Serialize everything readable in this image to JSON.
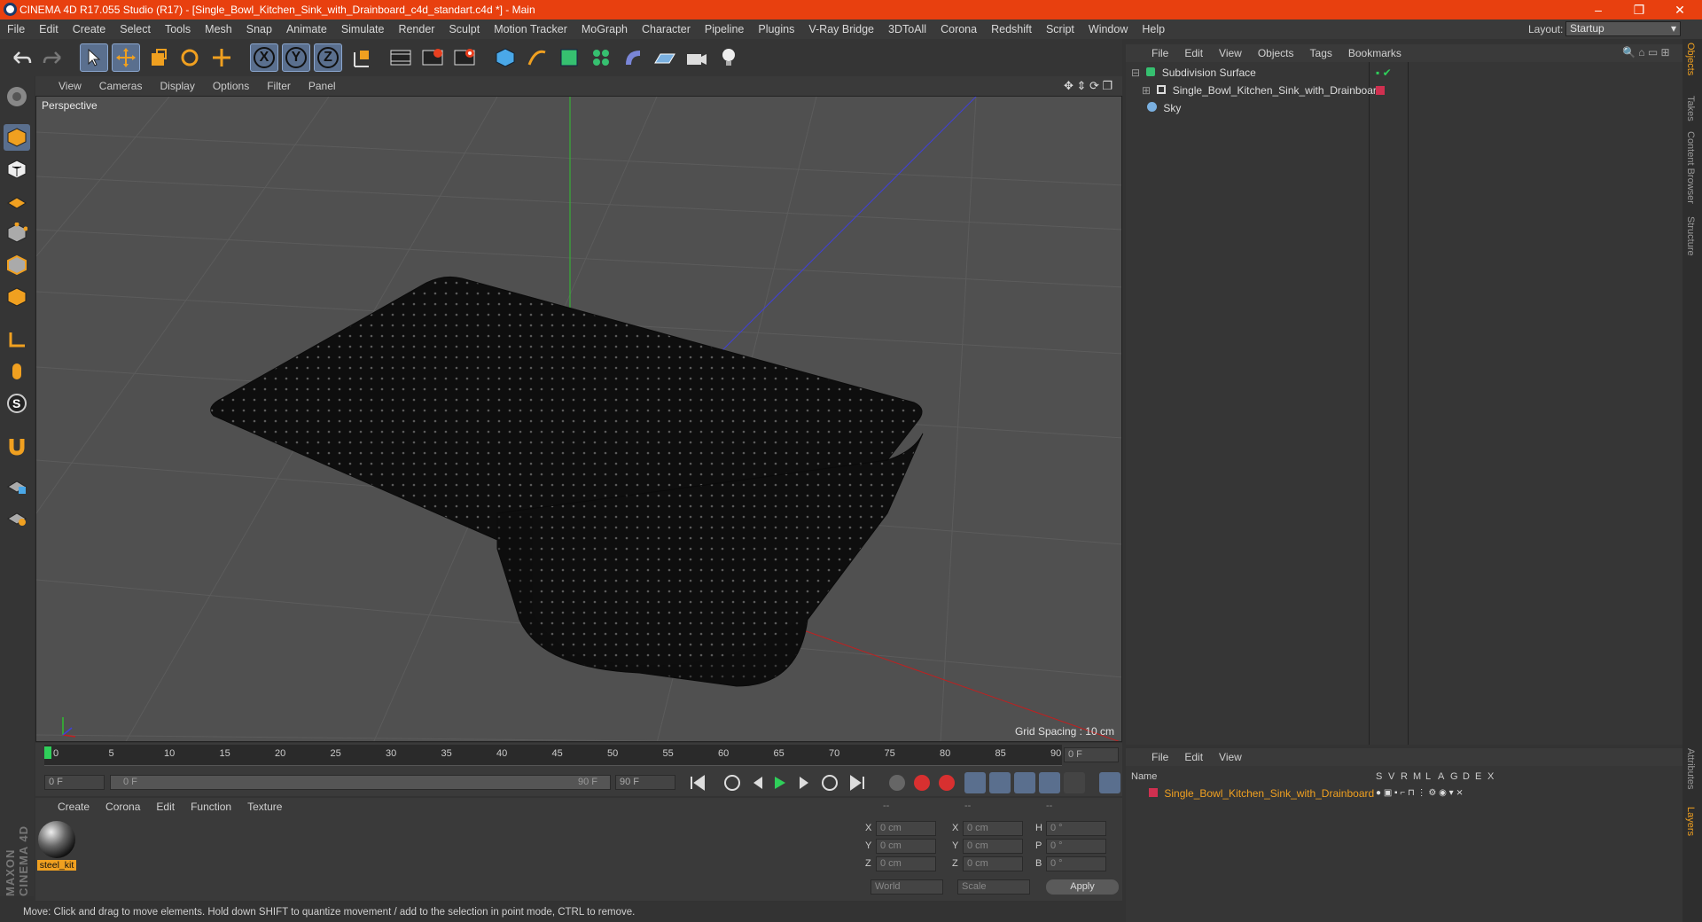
{
  "window": {
    "title": "CINEMA 4D R17.055 Studio (R17) - [Single_Bowl_Kitchen_Sink_with_Drainboard_c4d_standart.c4d *] - Main",
    "minimize": "–",
    "restore": "❐",
    "close": "✕"
  },
  "menubar": {
    "items": [
      "File",
      "Edit",
      "Create",
      "Select",
      "Tools",
      "Mesh",
      "Snap",
      "Animate",
      "Simulate",
      "Render",
      "Sculpt",
      "Motion Tracker",
      "MoGraph",
      "Character",
      "Pipeline",
      "Plugins",
      "V-Ray Bridge",
      "3DToAll",
      "Corona",
      "Redshift",
      "Script",
      "Window",
      "Help"
    ],
    "layout_label": "Layout:",
    "layout_value": "Startup"
  },
  "toolbar": {
    "axis_x": "X",
    "axis_y": "Y",
    "axis_z": "Z"
  },
  "viewport": {
    "menu": [
      "View",
      "Cameras",
      "Display",
      "Options",
      "Filter",
      "Panel"
    ],
    "label": "Perspective",
    "grid_spacing": "Grid Spacing : 10 cm"
  },
  "timeline": {
    "ticks": [
      "0",
      "5",
      "10",
      "15",
      "20",
      "25",
      "30",
      "35",
      "40",
      "45",
      "50",
      "55",
      "60",
      "65",
      "70",
      "75",
      "80",
      "85",
      "90"
    ],
    "current_frame": "0 F",
    "start": "0 F",
    "range_start": "0 F",
    "range_end": "90 F",
    "end": "90 F"
  },
  "material_manager": {
    "menu": [
      "Create",
      "Corona",
      "Edit",
      "Function",
      "Texture"
    ],
    "material_name": "steel_kit"
  },
  "coordinates": {
    "headers": [
      "--",
      "--",
      "--"
    ],
    "rows": [
      {
        "a": "X",
        "v1": "0 cm",
        "b": "X",
        "v2": "0 cm",
        "c": "H",
        "v3": "0 °"
      },
      {
        "a": "Y",
        "v1": "0 cm",
        "b": "Y",
        "v2": "0 cm",
        "c": "P",
        "v3": "0 °"
      },
      {
        "a": "Z",
        "v1": "0 cm",
        "b": "Z",
        "v2": "0 cm",
        "c": "B",
        "v3": "0 °"
      }
    ],
    "world": "World",
    "scale": "Scale",
    "apply": "Apply"
  },
  "status": "Move: Click and drag to move elements. Hold down SHIFT to quantize movement / add to the selection in point mode, CTRL to remove.",
  "object_manager": {
    "menu": [
      "File",
      "Edit",
      "View",
      "Objects",
      "Tags",
      "Bookmarks"
    ],
    "objects": [
      "Subdivision Surface",
      "Single_Bowl_Kitchen_Sink_with_Drainboard",
      "Sky"
    ]
  },
  "layer_manager": {
    "menu": [
      "File",
      "Edit",
      "View"
    ],
    "name_header": "Name",
    "columns": [
      "S",
      "V",
      "R",
      "M",
      "L",
      "A",
      "G",
      "D",
      "E",
      "X"
    ],
    "layer_name": "Single_Bowl_Kitchen_Sink_with_Drainboard"
  },
  "right_tabs": [
    "Objects",
    "Takes",
    "Content Browser",
    "Structure",
    "Attributes",
    "Layers"
  ],
  "branding": "MAXON CINEMA 4D",
  "colors": {
    "title_bar": "#e8400f",
    "highlight_orange": "#f0a020",
    "layer_red": "#d03050"
  }
}
